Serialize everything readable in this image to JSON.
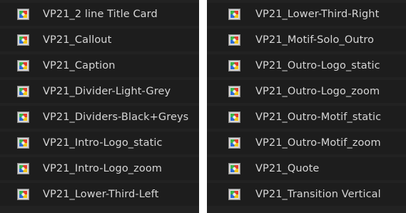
{
  "icon": "sequence-thumbnail-icon",
  "colors": {
    "panel_bg": "#222222",
    "row_bg": "#1d1d1d",
    "text": "#d6d6d6",
    "icon_frame": "#c9c9c9",
    "icon_green": "#3bb54a",
    "icon_red": "#e23b2e",
    "icon_blue": "#2a6bd6",
    "icon_yellow": "#f2c314"
  },
  "left_panel": {
    "items": [
      {
        "label": "VP21_2 line Title Card"
      },
      {
        "label": "VP21_Callout"
      },
      {
        "label": "VP21_Caption"
      },
      {
        "label": "VP21_Divider-Light-Grey"
      },
      {
        "label": "VP21_Dividers-Black+Greys"
      },
      {
        "label": "VP21_Intro-Logo_static"
      },
      {
        "label": "VP21_Intro-Logo_zoom"
      },
      {
        "label": "VP21_Lower-Third-Left"
      }
    ]
  },
  "right_panel": {
    "items": [
      {
        "label": "VP21_Lower-Third-Right"
      },
      {
        "label": "VP21_Motif-Solo_Outro"
      },
      {
        "label": "VP21_Outro-Logo_static"
      },
      {
        "label": "VP21_Outro-Logo_zoom"
      },
      {
        "label": "VP21_Outro-Motif_static"
      },
      {
        "label": "VP21_Outro-Motif_zoom"
      },
      {
        "label": "VP21_Quote"
      },
      {
        "label": "VP21_Transition Vertical"
      }
    ]
  }
}
